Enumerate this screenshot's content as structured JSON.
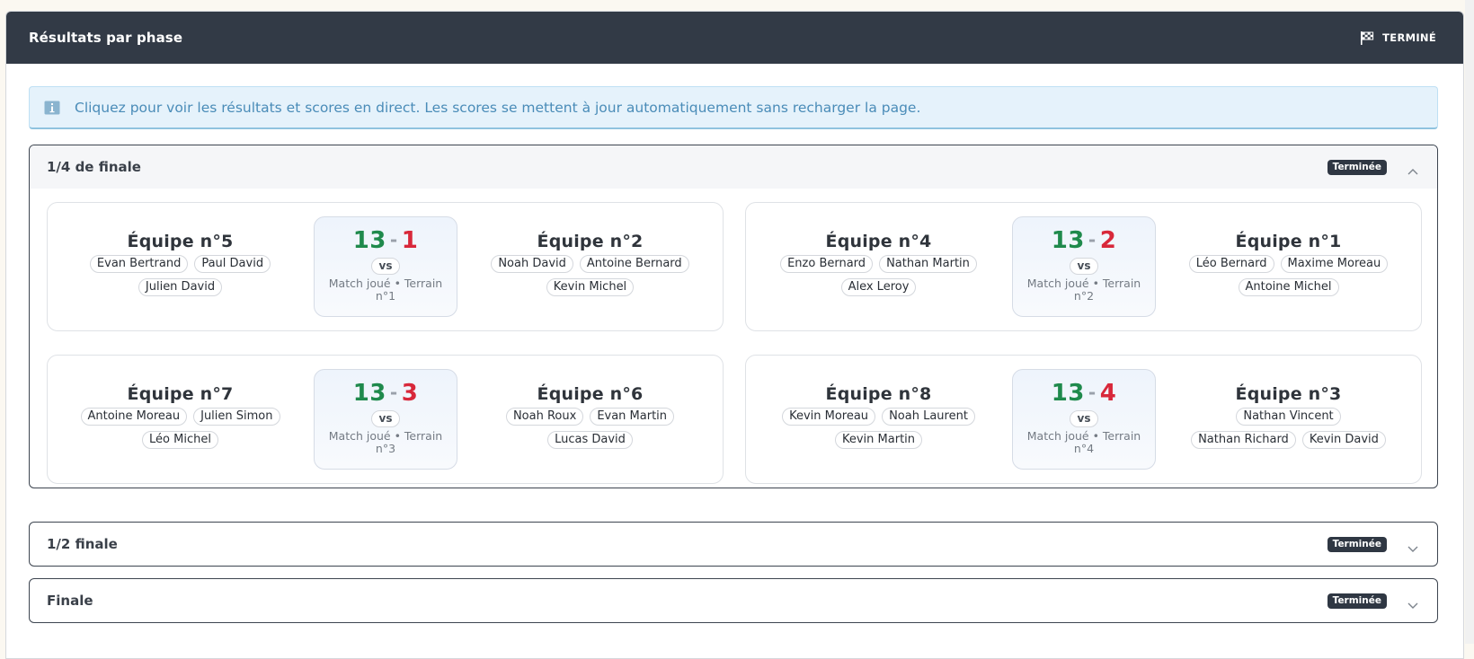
{
  "header": {
    "title": "Résultats par phase",
    "status_label": "TERMINÉ"
  },
  "alert": {
    "text": "Cliquez pour voir les résultats et scores en direct. Les scores se mettent à jour automatiquement sans recharger la page."
  },
  "phases": [
    {
      "title": "1/4 de finale",
      "badge": "Terminée",
      "expanded": true,
      "matches": [
        {
          "team_a": {
            "name": "Équipe n°5",
            "players": [
              "Evan Bertrand",
              "Paul David",
              "Julien David"
            ]
          },
          "score_a": "13",
          "score_b": "1",
          "vs": "vs",
          "info": "Match joué • Terrain n°1",
          "team_b": {
            "name": "Équipe n°2",
            "players": [
              "Noah David",
              "Antoine Bernard",
              "Kevin Michel"
            ]
          }
        },
        {
          "team_a": {
            "name": "Équipe n°4",
            "players": [
              "Enzo Bernard",
              "Nathan Martin",
              "Alex Leroy"
            ]
          },
          "score_a": "13",
          "score_b": "2",
          "vs": "vs",
          "info": "Match joué • Terrain n°2",
          "team_b": {
            "name": "Équipe n°1",
            "players": [
              "Léo Bernard",
              "Maxime Moreau",
              "Antoine Michel"
            ]
          }
        },
        {
          "team_a": {
            "name": "Équipe n°7",
            "players": [
              "Antoine Moreau",
              "Julien Simon",
              "Léo Michel"
            ]
          },
          "score_a": "13",
          "score_b": "3",
          "vs": "vs",
          "info": "Match joué • Terrain n°3",
          "team_b": {
            "name": "Équipe n°6",
            "players": [
              "Noah Roux",
              "Evan Martin",
              "Lucas David"
            ]
          }
        },
        {
          "team_a": {
            "name": "Équipe n°8",
            "players": [
              "Kevin Moreau",
              "Noah Laurent",
              "Kevin Martin"
            ]
          },
          "score_a": "13",
          "score_b": "4",
          "vs": "vs",
          "info": "Match joué • Terrain n°4",
          "team_b": {
            "name": "Équipe n°3",
            "players": [
              "Nathan Vincent",
              "Nathan Richard",
              "Kevin David"
            ]
          }
        }
      ]
    },
    {
      "title": "1/2 finale",
      "badge": "Terminée",
      "expanded": false
    },
    {
      "title": "Finale",
      "badge": "Terminée",
      "expanded": false
    }
  ],
  "colors": {
    "header_bg": "#323a46",
    "score_winner": "#1f8a4c",
    "score_loser": "#d8283a",
    "alert_bg": "#e5f2fb",
    "alert_text": "#4a8cb8"
  },
  "icons": {
    "header_status": "checkered-flag-icon",
    "alert": "info-icon",
    "phase_open": "chevron-up-icon",
    "phase_closed": "chevron-down-icon"
  }
}
